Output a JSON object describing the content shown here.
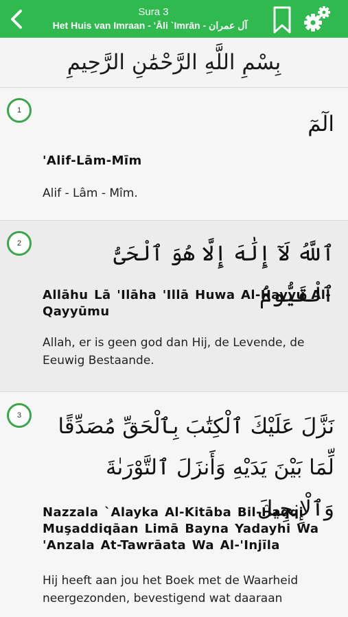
{
  "header": {
    "title": "Sura 3",
    "subtitle": "Het Huis van Imraan - 'Āli `Imrān - آل عمران",
    "back_icon": "chevron-left-icon",
    "bookmark_icon": "bookmark-icon",
    "settings_icon": "gears-icon",
    "background_color": "#2fb94f"
  },
  "bismillah": "بِسْمِ اللَّهِ الرَّحْمَٰنِ الرَّحِيمِ",
  "verses": [
    {
      "number": "1",
      "arabic": "الٓمٓ",
      "transliteration": "'Alif-Lām-Mīm",
      "translation": "Alif - Lâm - Mîm."
    },
    {
      "number": "2",
      "arabic": "ٱللَّهُ لَآ إِلَٰهَ إِلَّا هُوَ ٱلْحَىُّ ٱلْقَيُّومُ",
      "transliteration": "Allāhu Lā 'Ilāha 'Illā Huwa Al-Ĥayyu Al-Qayyūmu",
      "translation": "Allah, er is geen god dan Hij, de Levende, de Eeuwig Bestaande."
    },
    {
      "number": "3",
      "arabic": "نَزَّلَ عَلَيْكَ ٱلْكِتَٰبَ بِٱلْحَقِّ مُصَدِّقًا لِّمَا بَيْنَ يَدَيْهِ وَأَنزَلَ ٱلتَّوْرَىٰةَ وَٱلْإِنجِيلَ",
      "transliteration": "Nazzala `Alayka Al-Kitāba Bil-Ĥaqqi Muşaddiqāan Limā Bayna Yadayhi Wa 'Anzala At-Tawrāata Wa Al-'Injīla",
      "translation": "Hij heeft aan jou het Boek met de Waarheid neergezonden, bevestigend wat daaraan"
    }
  ]
}
